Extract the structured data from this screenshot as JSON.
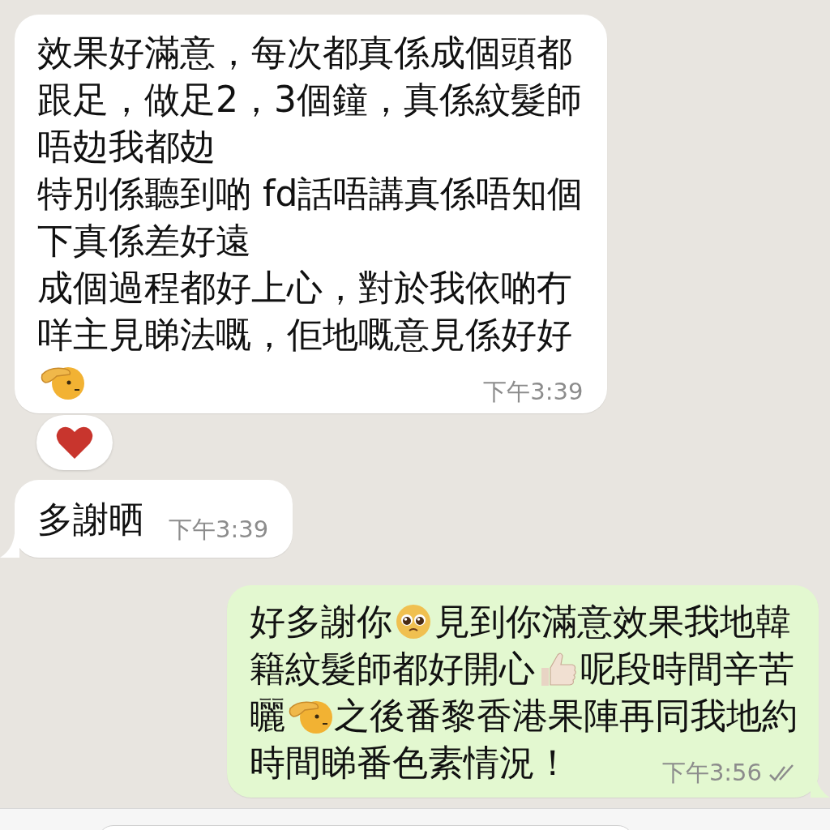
{
  "messages": [
    {
      "outgoing": false,
      "tail": false,
      "time": "下午3:39",
      "reaction": {
        "kind": "heart"
      },
      "lines": [
        [
          {
            "kind": "text",
            "text": "效果好滿意，每次都真係成個頭都"
          }
        ],
        [
          {
            "kind": "text",
            "text": "跟足，做足2，3個鐘，真係紋髮師"
          }
        ],
        [
          {
            "kind": "text",
            "text": "唔攰我都攰"
          }
        ],
        [
          {
            "kind": "text",
            "text": "特別係聽到啲 fd話唔講真係唔知個"
          }
        ],
        [
          {
            "kind": "text",
            "text": "下真係差好遠"
          }
        ],
        [
          {
            "kind": "text",
            "text": "成個過程都好上心，對於我依啲冇"
          }
        ],
        [
          {
            "kind": "text",
            "text": "咩主見睇法嘅，佢地嘅意見係好好"
          }
        ],
        [
          {
            "kind": "salute-emoji"
          }
        ]
      ]
    },
    {
      "outgoing": false,
      "tail": true,
      "time": "下午3:39",
      "lines": [
        [
          {
            "kind": "text",
            "text": "多謝晒"
          }
        ]
      ]
    },
    {
      "outgoing": true,
      "tail": true,
      "time": "下午3:56",
      "read": false,
      "lines": [
        [
          {
            "kind": "text",
            "text": "好多謝你"
          },
          {
            "kind": "pleading-emoji"
          },
          {
            "kind": "text",
            "text": "見到你滿意效果我地韓"
          }
        ],
        [
          {
            "kind": "text",
            "text": "籍紋髮師都好開心"
          },
          {
            "kind": "thumbs-up-emoji"
          },
          {
            "kind": "text",
            "text": "呢段時間辛苦"
          }
        ],
        [
          {
            "kind": "text",
            "text": "曬"
          },
          {
            "kind": "salute-emoji"
          },
          {
            "kind": "text",
            "text": "之後番黎香港果陣再同我地約"
          }
        ],
        [
          {
            "kind": "text",
            "text": "時間睇番色素情況！"
          }
        ]
      ]
    }
  ]
}
